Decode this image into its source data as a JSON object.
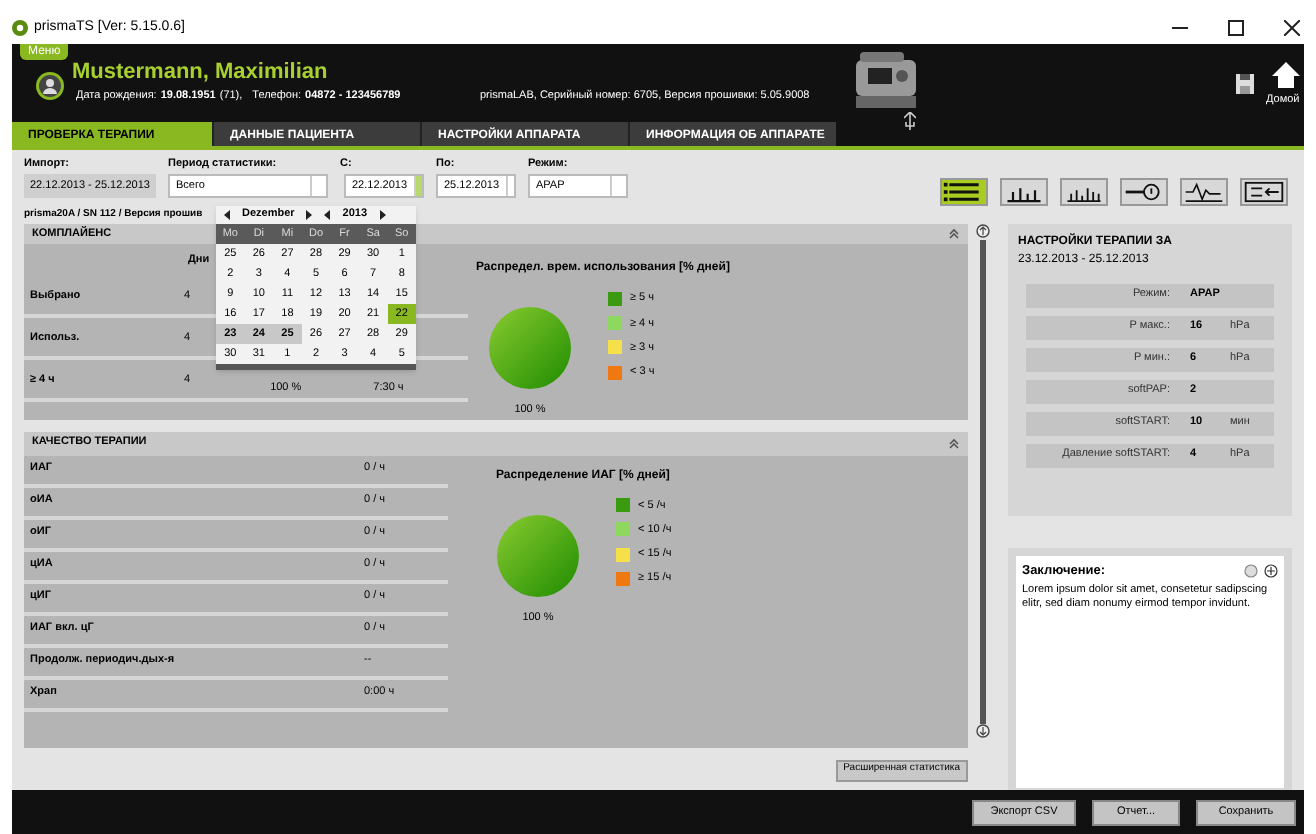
{
  "window": {
    "title": "prismaTS [Ver: 5.15.0.6]"
  },
  "header": {
    "menu": "Меню",
    "patient": "Mustermann, Maximilian",
    "birth_label": "Дата рождения:",
    "birth": "19.08.1951",
    "age": "(71),",
    "phone_label": "Телефон:",
    "phone": "04872 - 123456789",
    "device_info": "prismaLAB,  Серийный номер: 6705,  Версия прошивки: 5.05.9008",
    "home": "Домой"
  },
  "tabs": [
    {
      "label": "ПРОВЕРКА ТЕРАПИИ",
      "selected": true
    },
    {
      "label": "ДАННЫЕ ПАЦИЕНТА",
      "selected": false
    },
    {
      "label": "НАСТРОЙКИ АППАРАТА",
      "selected": false
    },
    {
      "label": "ИНФОРМАЦИЯ ОБ АППАРАТЕ",
      "selected": false
    }
  ],
  "filters": {
    "import_label": "Импорт:",
    "import_value": "22.12.2013 - 25.12.2013",
    "period_label": "Период статистики:",
    "period_value": "Всего",
    "from_label": "С:",
    "from_value": "22.12.2013",
    "to_label": "По:",
    "to_value": "25.12.2013",
    "mode_label": "Режим:",
    "mode_value": "APAP"
  },
  "device_line": "prisma20A / SN 112 / Версия прошив",
  "toolbar": [
    {
      "selected": true
    },
    {
      "selected": false
    },
    {
      "selected": false
    },
    {
      "selected": false
    },
    {
      "selected": false
    },
    {
      "selected": false
    }
  ],
  "calendar": {
    "month": "Dezember",
    "year": "2013",
    "weekdays": [
      "Mo",
      "Di",
      "Mi",
      "Do",
      "Fr",
      "Sa",
      "So"
    ],
    "days": [
      {
        "day": "25",
        "selected": false,
        "in_range": false
      },
      {
        "day": "26",
        "selected": false,
        "in_range": false
      },
      {
        "day": "27",
        "selected": false,
        "in_range": false
      },
      {
        "day": "28",
        "selected": false,
        "in_range": false
      },
      {
        "day": "29",
        "selected": false,
        "in_range": false
      },
      {
        "day": "30",
        "selected": false,
        "in_range": false
      },
      {
        "day": "1",
        "selected": false,
        "in_range": false
      },
      {
        "day": "2",
        "selected": false,
        "in_range": false
      },
      {
        "day": "3",
        "selected": false,
        "in_range": false
      },
      {
        "day": "4",
        "selected": false,
        "in_range": false
      },
      {
        "day": "5",
        "selected": false,
        "in_range": false
      },
      {
        "day": "6",
        "selected": false,
        "in_range": false
      },
      {
        "day": "7",
        "selected": false,
        "in_range": false
      },
      {
        "day": "8",
        "selected": false,
        "in_range": false
      },
      {
        "day": "9",
        "selected": false,
        "in_range": false
      },
      {
        "day": "10",
        "selected": false,
        "in_range": false
      },
      {
        "day": "11",
        "selected": false,
        "in_range": false
      },
      {
        "day": "12",
        "selected": false,
        "in_range": false
      },
      {
        "day": "13",
        "selected": false,
        "in_range": false
      },
      {
        "day": "14",
        "selected": false,
        "in_range": false
      },
      {
        "day": "15",
        "selected": false,
        "in_range": false
      },
      {
        "day": "16",
        "selected": false,
        "in_range": false
      },
      {
        "day": "17",
        "selected": false,
        "in_range": false
      },
      {
        "day": "18",
        "selected": false,
        "in_range": false
      },
      {
        "day": "19",
        "selected": false,
        "in_range": false
      },
      {
        "day": "20",
        "selected": false,
        "in_range": false
      },
      {
        "day": "21",
        "selected": false,
        "in_range": false
      },
      {
        "day": "22",
        "selected": true,
        "in_range": false
      },
      {
        "day": "23",
        "selected": false,
        "in_range": true
      },
      {
        "day": "24",
        "selected": false,
        "in_range": true
      },
      {
        "day": "25",
        "selected": false,
        "in_range": true
      },
      {
        "day": "26",
        "selected": false,
        "in_range": false
      },
      {
        "day": "27",
        "selected": false,
        "in_range": false
      },
      {
        "day": "28",
        "selected": false,
        "in_range": false
      },
      {
        "day": "29",
        "selected": false,
        "in_range": false
      },
      {
        "day": "30",
        "selected": false,
        "in_range": false
      },
      {
        "day": "31",
        "selected": false,
        "in_range": false
      },
      {
        "day": "1",
        "selected": false,
        "in_range": false
      },
      {
        "day": "2",
        "selected": false,
        "in_range": false
      },
      {
        "day": "3",
        "selected": false,
        "in_range": false
      },
      {
        "day": "4",
        "selected": false,
        "in_range": false
      },
      {
        "day": "5",
        "selected": false,
        "in_range": false
      }
    ]
  },
  "compliance": {
    "title": "КОМПЛАЙЕНС",
    "column_header": "Дни",
    "rows": [
      {
        "label": "Выбрано",
        "days": "4"
      },
      {
        "label": "Использ.",
        "days": "4"
      },
      {
        "label": "≥ 4 ч",
        "days": "4",
        "column_2": "100 %",
        "column_3": "7:30 ч"
      }
    ],
    "chart_title": "Распредел. врем. использования [% дней]",
    "pie_label": "100 %",
    "legend": [
      {
        "label": "≥ 5 ч",
        "color": "#3a9a10"
      },
      {
        "label": "≥ 4 ч",
        "color": "#8fd860"
      },
      {
        "label": "≥ 3 ч",
        "color": "#f5e04a"
      },
      {
        "label": "< 3 ч",
        "color": "#f07810"
      }
    ]
  },
  "quality": {
    "title": "КАЧЕСТВО ТЕРАПИИ",
    "rows": [
      {
        "label": "ИАГ",
        "value": "0 / ч"
      },
      {
        "label": "оИА",
        "value": "0 / ч"
      },
      {
        "label": "оИГ",
        "value": "0 / ч"
      },
      {
        "label": "цИА",
        "value": "0 / ч"
      },
      {
        "label": "цИГ",
        "value": "0 / ч"
      },
      {
        "label": "ИАГ вкл. цГ",
        "value": "0 / ч"
      },
      {
        "label": "Продолж. периодич.дых-я",
        "value": "--"
      },
      {
        "label": "Храп",
        "value": "0:00 ч"
      }
    ],
    "chart_title": "Распределение ИАГ [% дней]",
    "pie_label": "100 %",
    "legend": [
      {
        "label": "< 5 /ч",
        "color": "#3a9a10"
      },
      {
        "label": "< 10 /ч",
        "color": "#8fd860"
      },
      {
        "label": "< 15 /ч",
        "color": "#f5e04a"
      },
      {
        "label": "≥ 15 /ч",
        "color": "#f07810"
      }
    ]
  },
  "extended_button": "Расширенная статистика",
  "settings": {
    "title": "НАСТРОЙКИ ТЕРАПИИ ЗА",
    "period": "23.12.2013  -  25.12.2013",
    "rows": [
      {
        "label": "Режим:",
        "value": "APAP"
      },
      {
        "label": "P макс.:",
        "value": "16",
        "unit": "hPa"
      },
      {
        "label": "P мин.:",
        "value": "6",
        "unit": "hPa"
      },
      {
        "label": "softPAP:",
        "value": "2"
      },
      {
        "label": "softSTART:",
        "value": "10",
        "unit": "мин"
      },
      {
        "label": "Давление softSTART:",
        "value": "4",
        "unit": "hPa"
      }
    ]
  },
  "conclusion": {
    "title": "Заключение:",
    "text": "Lorem ipsum dolor sit amet, consetetur sadipscing elitr, sed diam nonumy eirmod tempor invidunt."
  },
  "buttons": [
    "Экспорт CSV",
    "Отчет...",
    "Сохранить"
  ]
}
